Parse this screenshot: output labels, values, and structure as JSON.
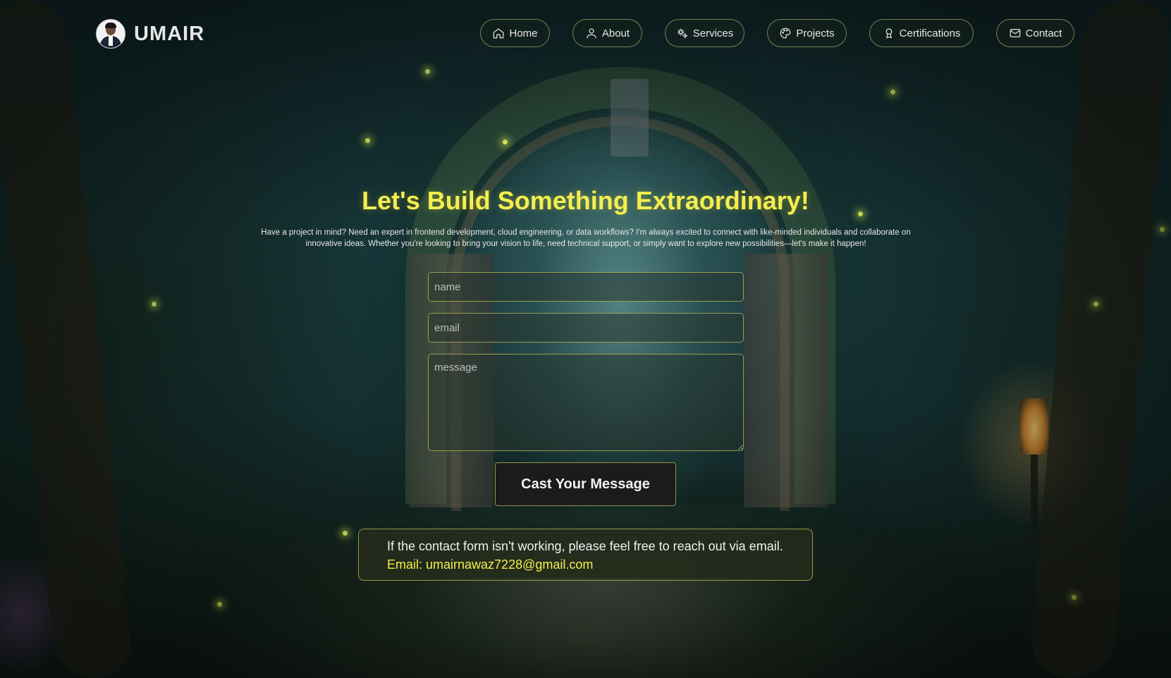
{
  "header": {
    "brand": "UMAIR",
    "nav": [
      {
        "label": "Home",
        "icon": "home-icon"
      },
      {
        "label": "About",
        "icon": "user-icon"
      },
      {
        "label": "Services",
        "icon": "gears-icon"
      },
      {
        "label": "Projects",
        "icon": "palette-icon"
      },
      {
        "label": "Certifications",
        "icon": "award-icon"
      },
      {
        "label": "Contact",
        "icon": "mail-icon"
      }
    ]
  },
  "main": {
    "title": "Let's Build Something Extraordinary!",
    "intro": "Have a project in mind? Need an expert in frontend development, cloud engineering, or data workflows? I'm always excited to connect with like-minded individuals and collaborate on innovative ideas. Whether you're looking to bring your vision to life, need technical support, or simply want to explore new possibilities—let's make it happen!",
    "form": {
      "name_placeholder": "name",
      "email_placeholder": "email",
      "message_placeholder": "message",
      "submit_label": "Cast Your Message"
    },
    "notice": {
      "text": "If the contact form isn't working, please feel free to reach out via email.",
      "email_line": "Email: umairnawaz7228@gmail.com"
    }
  },
  "colors": {
    "accent": "#f4ee4e",
    "border": "#c8c85a",
    "button_bg": "#1b1b1b"
  }
}
